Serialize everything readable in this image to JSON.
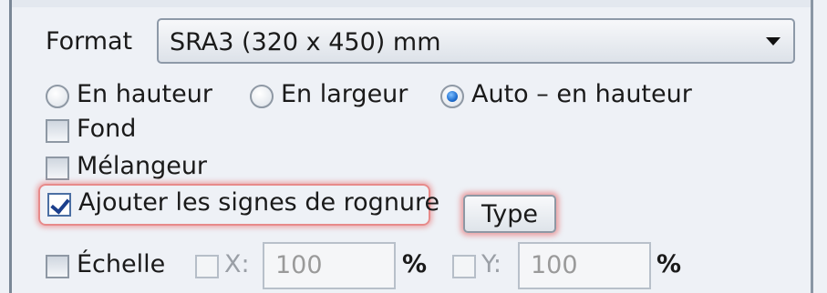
{
  "format": {
    "label": "Format",
    "selected": "SRA3 (320 x 450) mm"
  },
  "orientation": {
    "options": [
      {
        "label": "En hauteur",
        "checked": false
      },
      {
        "label": "En largeur",
        "checked": false
      },
      {
        "label": "Auto – en hauteur",
        "checked": true
      }
    ]
  },
  "checkboxes": {
    "fond": {
      "label": "Fond",
      "checked": false
    },
    "melangeur": {
      "label": "Mélangeur",
      "checked": false
    },
    "rognure": {
      "label": "Ajouter les signes de rognure",
      "checked": true
    }
  },
  "type_button": {
    "label": "Type"
  },
  "echelle": {
    "label": "Échelle",
    "checked": false,
    "x": {
      "label": "X:",
      "value": "100",
      "unit": "%"
    },
    "y": {
      "label": "Y:",
      "value": "100",
      "unit": "%"
    }
  }
}
